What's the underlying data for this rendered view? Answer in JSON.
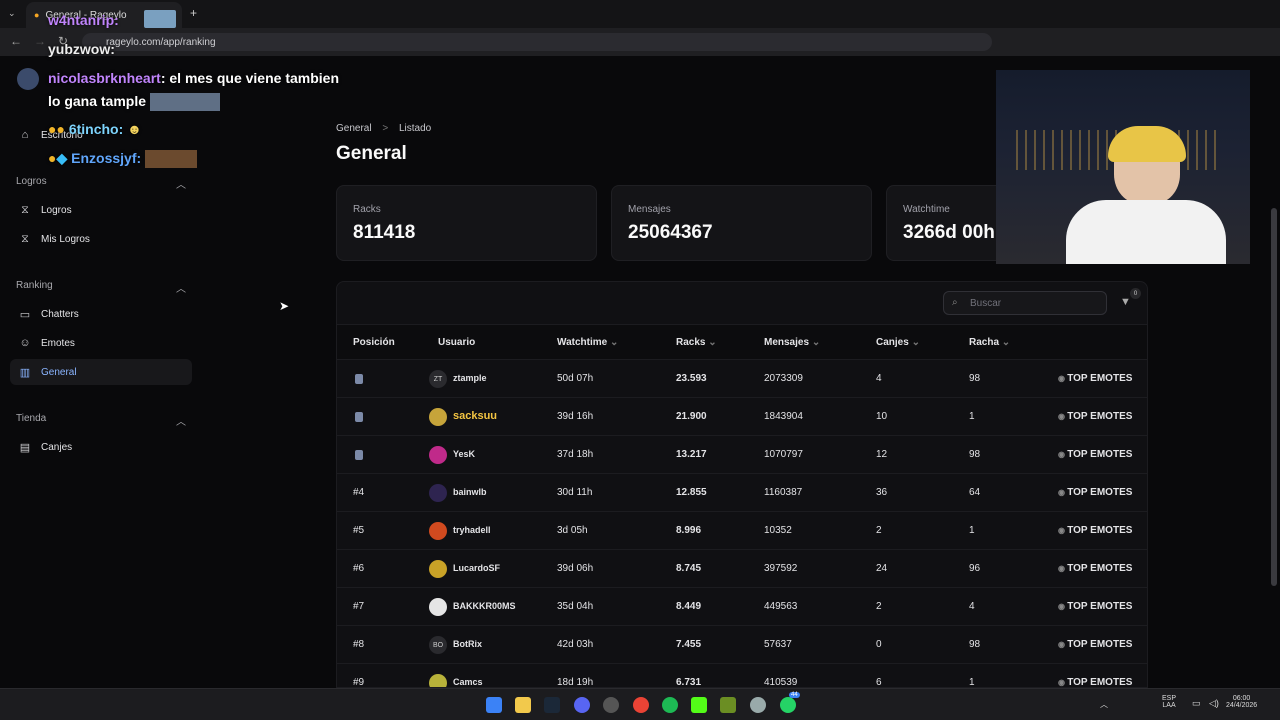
{
  "browser": {
    "tab_title": "General - Rageylo",
    "url": "rageylo.com/app/ranking",
    "new_tab": "+"
  },
  "sidebar": {
    "escritorio": "Escritorio",
    "sections": [
      {
        "title": "Logros",
        "items": [
          "Logros",
          "Mis Logros"
        ]
      },
      {
        "title": "Ranking",
        "items": [
          "Chatters",
          "Emotes",
          "General"
        ]
      },
      {
        "title": "Tienda",
        "items": [
          "Canjes"
        ]
      }
    ],
    "active": "General"
  },
  "chat": {
    "line1_user": "w4ntanrip:",
    "line2": "yubzwow:",
    "line3_user": "nicolasbrknheart",
    "line3_text": ": el mes que viene tambien",
    "line4_text": "lo gana tample",
    "line5_user": "6tincho:",
    "line6_user": "Enzossjyf:"
  },
  "breadcrumb": {
    "root": "General",
    "sep": ">",
    "current": "Listado"
  },
  "page_title": "General",
  "stats": [
    {
      "label": "Racks",
      "value": "811418"
    },
    {
      "label": "Mensajes",
      "value": "25064367"
    },
    {
      "label": "Watchtime",
      "value": "3266d 00h"
    }
  ],
  "search": {
    "placeholder": "Buscar",
    "filter_count": "0"
  },
  "columns": [
    "Posición",
    "Usuario",
    "Watchtime",
    "Racks",
    "Mensajes",
    "Canjes",
    "Racha"
  ],
  "rows": [
    {
      "pos": "",
      "avatar": "ZT",
      "user": "ztample",
      "watch": "50d 07h",
      "racks": "23.593",
      "msgs": "2073309",
      "canjes": "4",
      "racha": "98",
      "action": "TOP EMOTES"
    },
    {
      "pos": "",
      "avatar": "",
      "user": "sacksuu",
      "watch": "39d 16h",
      "racks": "21.900",
      "msgs": "1843904",
      "canjes": "10",
      "racha": "1",
      "action": "TOP EMOTES"
    },
    {
      "pos": "",
      "avatar": "",
      "user": "YesK",
      "watch": "37d 18h",
      "racks": "13.217",
      "msgs": "1070797",
      "canjes": "12",
      "racha": "98",
      "action": "TOP EMOTES"
    },
    {
      "pos": "#4",
      "avatar": "",
      "user": "bainwlb",
      "watch": "30d 11h",
      "racks": "12.855",
      "msgs": "1160387",
      "canjes": "36",
      "racha": "64",
      "action": "TOP EMOTES"
    },
    {
      "pos": "#5",
      "avatar": "",
      "user": "tryhadell",
      "watch": "3d 05h",
      "racks": "8.996",
      "msgs": "10352",
      "canjes": "2",
      "racha": "1",
      "action": "TOP EMOTES"
    },
    {
      "pos": "#6",
      "avatar": "",
      "user": "LucardoSF",
      "watch": "39d 06h",
      "racks": "8.745",
      "msgs": "397592",
      "canjes": "24",
      "racha": "96",
      "action": "TOP EMOTES"
    },
    {
      "pos": "#7",
      "avatar": "",
      "user": "BAKKKR00MS",
      "watch": "35d 04h",
      "racks": "8.449",
      "msgs": "449563",
      "canjes": "2",
      "racha": "4",
      "action": "TOP EMOTES"
    },
    {
      "pos": "#8",
      "avatar": "BO",
      "user": "BotRix",
      "watch": "42d 03h",
      "racks": "7.455",
      "msgs": "57637",
      "canjes": "0",
      "racha": "98",
      "action": "TOP EMOTES"
    },
    {
      "pos": "#9",
      "avatar": "",
      "user": "Camcs",
      "watch": "18d 19h",
      "racks": "6.731",
      "msgs": "410539",
      "canjes": "6",
      "racha": "1",
      "action": "TOP EMOTES"
    }
  ],
  "taskbar": {
    "lang1": "ESP",
    "lang2": "LAA",
    "time": "06:00",
    "date": "24/4/2026",
    "whatsapp_badge": "44"
  },
  "colors": {
    "accent": "#8ab4ff",
    "gold_user": "#f4c542"
  }
}
